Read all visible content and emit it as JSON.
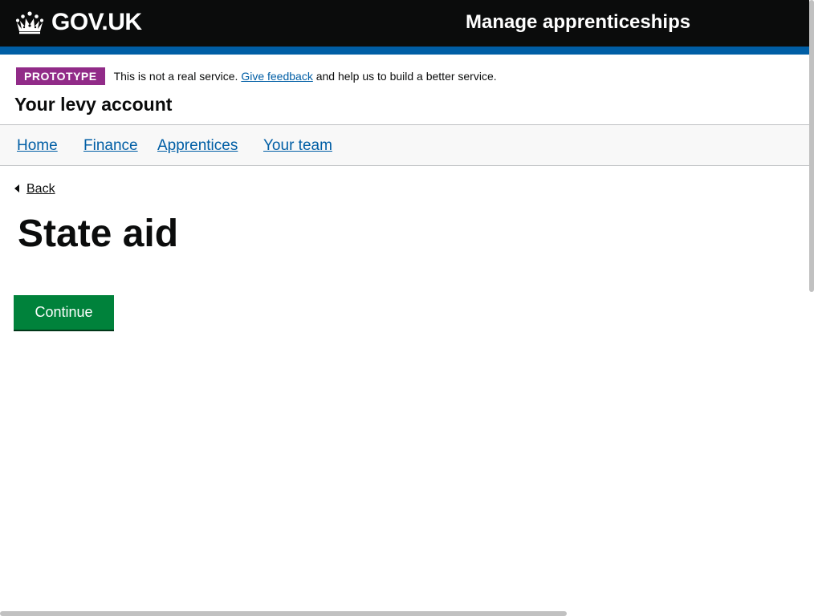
{
  "header": {
    "logo_text": "GOV.UK",
    "logo_icon": "crown-icon",
    "service_name": "Manage apprenticeships",
    "background_color": "#0b0c0c",
    "stripe_color": "#005ea5"
  },
  "phase_banner": {
    "tag": "PROTOTYPE",
    "tag_color": "#912b88",
    "text_before": "This is not a real service.",
    "link": "Give feedback",
    "text_after": "and help us to build a better service."
  },
  "account_title": "Your levy account",
  "nav": {
    "items": [
      {
        "label": "Home"
      },
      {
        "label": "Finance"
      },
      {
        "label": "Apprentices"
      },
      {
        "label": "Your team"
      }
    ]
  },
  "back_link": {
    "label": "Back",
    "icon": "back-arrow-icon"
  },
  "page_title": "State aid",
  "continue_button": {
    "label": "Continue",
    "color": "#00823b"
  }
}
